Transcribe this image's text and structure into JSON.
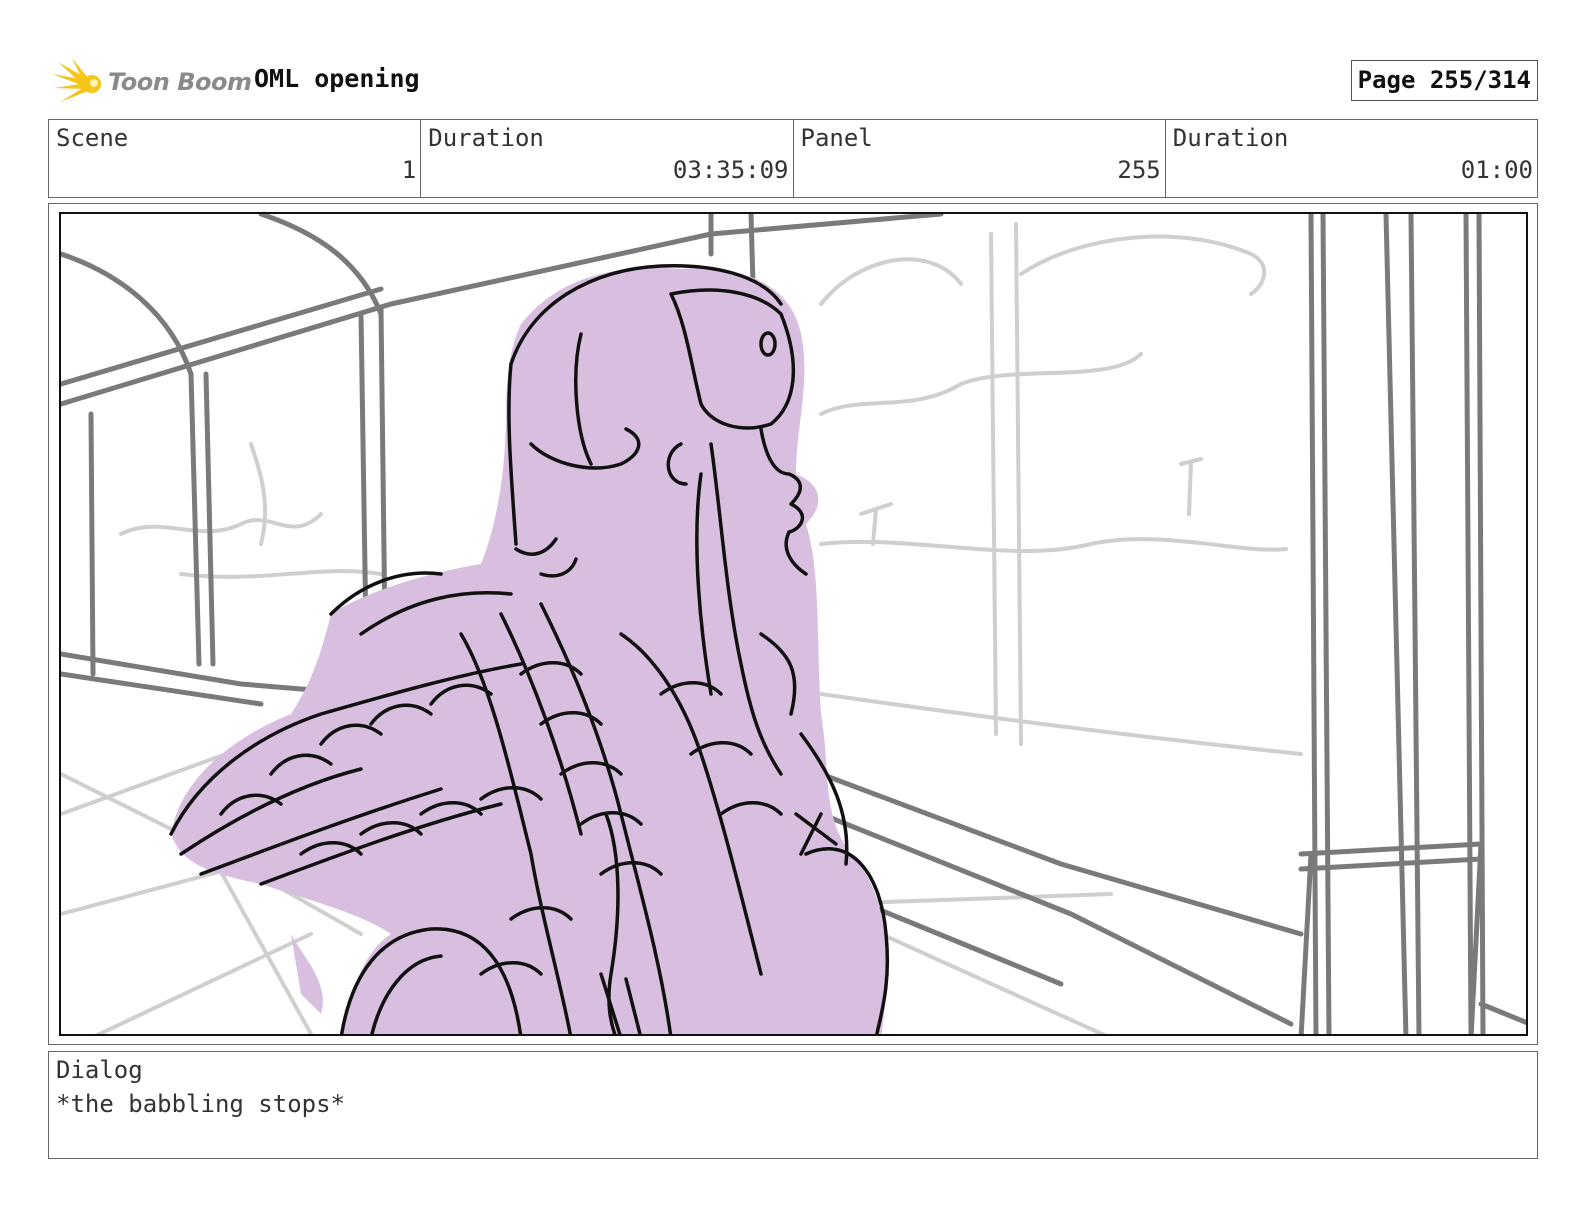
{
  "header": {
    "logo_text": "Toon Boom",
    "project_title": "OML opening",
    "page_label": "Page 255/314"
  },
  "info": {
    "scene_label": "Scene",
    "scene_value": "1",
    "duration_label": "Duration",
    "duration_value": "03:35:09",
    "panel_label": "Panel",
    "panel_value": "255",
    "panel_duration_label": "Duration",
    "panel_duration_value": "01:00"
  },
  "dialog": {
    "label": "Dialog",
    "text": "*the babbling stops*"
  },
  "colors": {
    "logo_yellow": "#f5c518",
    "character_fill": "#d8bfdf",
    "sketch_dark": "#111111",
    "sketch_gray": "#7a7a7a",
    "sketch_light": "#c8c8c8"
  }
}
